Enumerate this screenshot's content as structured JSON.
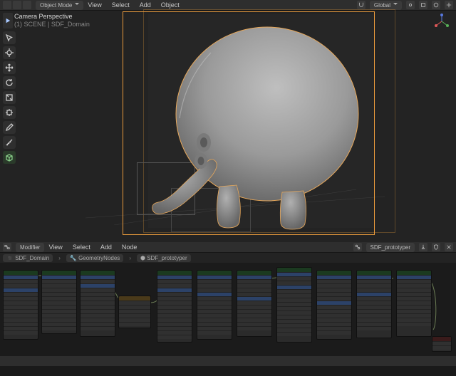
{
  "viewport": {
    "header": {
      "mode": "Object Mode",
      "menus": [
        "View",
        "Select",
        "Add",
        "Object"
      ],
      "orientation": "Global"
    },
    "overlay": {
      "title": "Camera Perspective",
      "sub": "(1) SCENE | SDF_Domain"
    }
  },
  "node_editor": {
    "header": {
      "mode": "Modifier",
      "menus": [
        "View",
        "Select",
        "Add",
        "Node"
      ],
      "group_label": "SDF_prototyper"
    },
    "breadcrumb": {
      "object_icon": "cube",
      "object": "SDF_Domain",
      "modifier_icon": "wrench",
      "modifier": "GeometryNodes",
      "group_icon": "nodes",
      "group": "SDF_prototyper"
    }
  }
}
